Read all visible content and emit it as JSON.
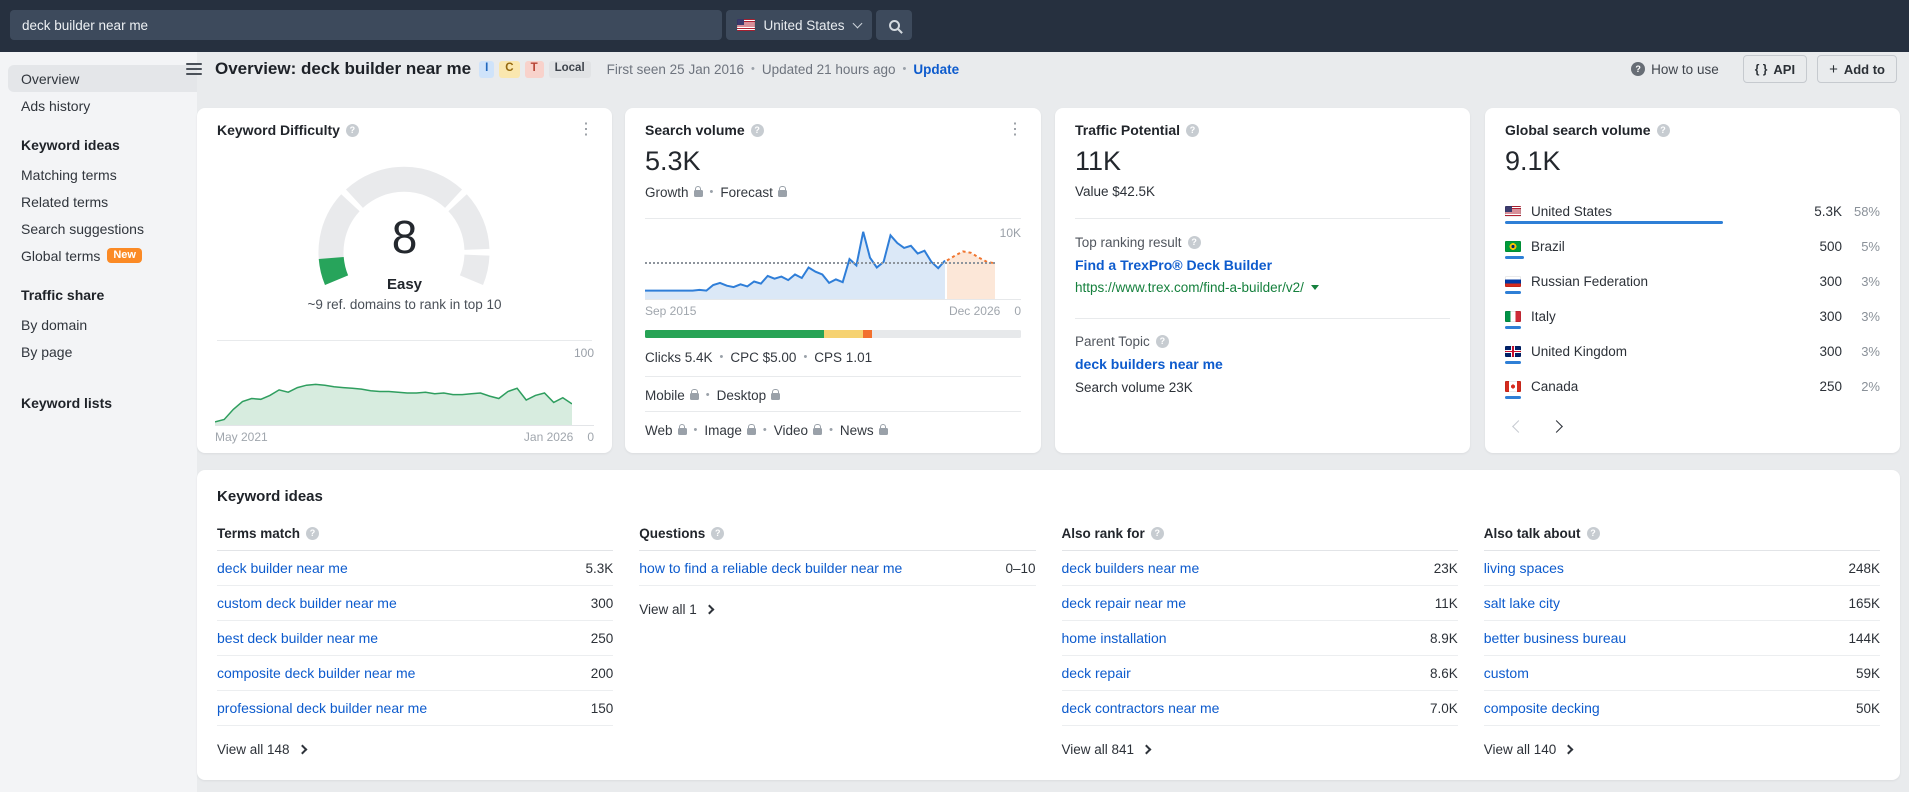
{
  "icons": {
    "kebab": "⋮",
    "plus": "+",
    "braces": "{ }",
    "dot": "•"
  },
  "topbar": {
    "search_value": "deck builder near me",
    "country": "United States",
    "country_flag": "us"
  },
  "sidebar": {
    "groups": [
      {
        "header": null,
        "items": [
          {
            "label": "Overview",
            "selected": true
          },
          {
            "label": "Ads history"
          }
        ]
      },
      {
        "header": "Keyword ideas",
        "items": [
          {
            "label": "Matching terms"
          },
          {
            "label": "Related terms"
          },
          {
            "label": "Search suggestions"
          },
          {
            "label": "Global terms",
            "badge": "New"
          }
        ]
      },
      {
        "header": "Traffic share",
        "items": [
          {
            "label": "By domain"
          },
          {
            "label": "By page"
          }
        ]
      },
      {
        "header": "Keyword lists",
        "items": []
      }
    ]
  },
  "header": {
    "title": "Overview: deck builder near me",
    "intent_badges": [
      {
        "label": "I",
        "bg": "#cfe3fa",
        "fg": "#2268bd"
      },
      {
        "label": "C",
        "bg": "#fae7af",
        "fg": "#95690f"
      },
      {
        "label": "T",
        "bg": "#f8d2cb",
        "fg": "#b64334"
      },
      {
        "label": "Local",
        "bg": "#e1e3e5",
        "fg": "#3d434b"
      }
    ],
    "first_seen": "First seen 25 Jan 2016",
    "updated": "Updated 21 hours ago",
    "update_link": "Update",
    "how_to_use": "How to use",
    "api_button": "API",
    "add_to_button": "Add to"
  },
  "cards": {
    "keyword_difficulty": {
      "title": "Keyword Difficulty",
      "value": 8,
      "label": "Easy",
      "subtitle": "~9 ref. domains to rank in top 10",
      "axis_top": "100",
      "axis_bottom": "0",
      "date_start": "May 2021",
      "date_end": "Jan 2026"
    },
    "search_volume": {
      "title": "Search volume",
      "value": "5.3K",
      "locked_links": [
        "Growth",
        "Forecast"
      ],
      "axis_top": "10K",
      "axis_bottom": "0",
      "date_start": "Sep 2015",
      "date_end": "Dec 2026",
      "metrics": [
        {
          "label": "Clicks",
          "value": "5.4K"
        },
        {
          "label": "CPC",
          "value": "$5.00"
        },
        {
          "label": "CPS",
          "value": "1.01"
        }
      ],
      "device_links": [
        "Mobile",
        "Desktop"
      ],
      "channel_links": [
        "Web",
        "Image",
        "Video",
        "News"
      ]
    },
    "traffic_potential": {
      "title": "Traffic Potential",
      "value": "11K",
      "value_label": "Value $42.5K",
      "top_ranking_label": "Top ranking result",
      "top_ranking_title": "Find a TrexPro® Deck Builder",
      "top_ranking_url": "https://www.trex.com/find-a-builder/v2/",
      "parent_topic_label": "Parent Topic",
      "parent_topic": "deck builders near me",
      "parent_topic_volume": "Search volume 23K"
    },
    "global_search_volume": {
      "title": "Global search volume",
      "value": "9.1K",
      "countries": [
        {
          "flag": "us",
          "name": "United States",
          "value": "5.3K",
          "pct": "58%",
          "bar": 58
        },
        {
          "flag": "br",
          "name": "Brazil",
          "value": "500",
          "pct": "5%",
          "bar": 5
        },
        {
          "flag": "ru",
          "name": "Russian Federation",
          "value": "300",
          "pct": "3%",
          "bar": 3
        },
        {
          "flag": "it",
          "name": "Italy",
          "value": "300",
          "pct": "3%",
          "bar": 3
        },
        {
          "flag": "gb",
          "name": "United Kingdom",
          "value": "300",
          "pct": "3%",
          "bar": 3
        },
        {
          "flag": "ca",
          "name": "Canada",
          "value": "250",
          "pct": "2%",
          "bar": 2
        }
      ]
    }
  },
  "keyword_ideas": {
    "title": "Keyword ideas",
    "columns": [
      {
        "header": "Terms match",
        "rows": [
          [
            "deck builder near me",
            "5.3K"
          ],
          [
            "custom deck builder near me",
            "300"
          ],
          [
            "best deck builder near me",
            "250"
          ],
          [
            "composite deck builder near me",
            "200"
          ],
          [
            "professional deck builder near me",
            "150"
          ]
        ],
        "view_all": "View all 148"
      },
      {
        "header": "Questions",
        "rows": [
          [
            "how to find a reliable deck builder near me",
            "0–10"
          ]
        ],
        "view_all": "View all 1"
      },
      {
        "header": "Also rank for",
        "rows": [
          [
            "deck builders near me",
            "23K"
          ],
          [
            "deck repair near me",
            "11K"
          ],
          [
            "home installation",
            "8.9K"
          ],
          [
            "deck repair",
            "8.6K"
          ],
          [
            "deck contractors near me",
            "7.0K"
          ]
        ],
        "view_all": "View all 841"
      },
      {
        "header": "Also talk about",
        "rows": [
          [
            "living spaces",
            "248K"
          ],
          [
            "salt lake city",
            "165K"
          ],
          [
            "better business bureau",
            "144K"
          ],
          [
            "custom",
            "59K"
          ],
          [
            "composite decking",
            "50K"
          ]
        ],
        "view_all": "View all 140"
      }
    ]
  },
  "chart_data": [
    {
      "id": "kd-gauge",
      "type": "gauge",
      "title": "Keyword Difficulty",
      "value": 8,
      "range": [
        0,
        100
      ],
      "label": "Easy",
      "color": "#27a45b",
      "zones": [
        [
          0,
          29
        ],
        [
          31,
          69
        ],
        [
          71,
          89
        ],
        [
          91,
          100
        ]
      ]
    },
    {
      "id": "kd-history",
      "type": "area",
      "title": "Keyword Difficulty history",
      "xlabel_start": "May 2021",
      "xlabel_end": "Jan 2026",
      "ylim": [
        0,
        100
      ],
      "values": [
        4,
        7,
        20,
        30,
        34,
        33,
        38,
        45,
        42,
        48,
        51,
        52,
        51,
        49,
        48,
        47,
        46,
        44,
        43,
        43,
        42,
        41,
        41,
        42,
        40,
        41,
        39,
        39,
        40,
        41,
        37,
        34,
        43,
        47,
        32,
        38,
        41,
        29,
        35,
        27
      ]
    },
    {
      "id": "sv-history",
      "type": "area",
      "title": "Search volume history",
      "xlabel_start": "Sep 2015",
      "xlabel_end": "Dec 2026",
      "units": "K",
      "ymax": 10,
      "current_level": 5.3,
      "series": [
        {
          "name": "history",
          "values": [
            1.2,
            1.2,
            1.2,
            1.2,
            1.2,
            1.2,
            1.2,
            1.2,
            1.3,
            1.2,
            2.0,
            2.3,
            1.9,
            1.7,
            2.1,
            1.8,
            2.5,
            2.2,
            3.3,
            2.9,
            3.2,
            2.7,
            3.5,
            3.0,
            4.5,
            3.9,
            3.5,
            2.3,
            2.8,
            2.4,
            5.7,
            4.8,
            9.6,
            5.9,
            4.5,
            5.3,
            9.1,
            8.0,
            7.3,
            7.6,
            6.5,
            6.9,
            5.3,
            4.4,
            5.5
          ]
        },
        {
          "name": "forecast",
          "values": [
            5.5,
            6.2,
            6.8,
            6.6,
            5.9,
            5.3,
            5.1
          ]
        }
      ]
    },
    {
      "id": "clicks-bar",
      "type": "bar",
      "title": "Clicks distribution",
      "segments": [
        {
          "color": "#27a355",
          "pct": 47.5
        },
        {
          "color": "#f6d271",
          "pct": 10.5
        },
        {
          "color": "#f2702e",
          "pct": 2.5
        },
        {
          "color": "#e7e9eb",
          "pct": 39.5
        }
      ]
    }
  ]
}
